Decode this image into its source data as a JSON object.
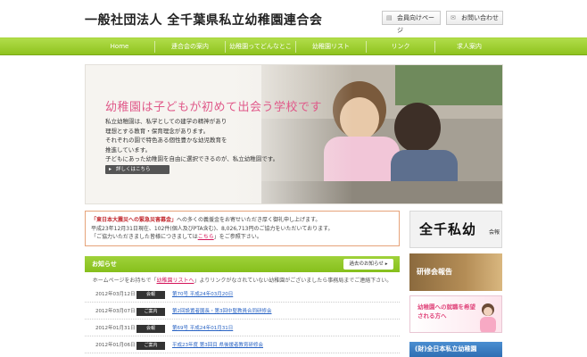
{
  "header": {
    "site_title": "一般社団法人 全千葉県私立幼稚園連合会",
    "member_page_label": "会員向けページ",
    "contact_label": "お問い合わせ"
  },
  "nav": {
    "items": [
      {
        "label": "Home"
      },
      {
        "label": "連合会の案内"
      },
      {
        "label": "幼稚園ってどんなところ?"
      },
      {
        "label": "幼稚園リスト"
      },
      {
        "label": "リンク"
      },
      {
        "label": "求人案内"
      }
    ]
  },
  "hero": {
    "headline": "幼稚園は子どもが初めて出会う学校です",
    "body_lines": [
      "私立幼稚園は、私学としての建学の精神があり",
      "理想とする教育・保育理念があります。",
      "それぞれの園で特色ある個性豊かな幼児教育を",
      "推進しています。",
      "子どもにあった幼稚園を自由に選択できるのが、私立幼稚園です。"
    ],
    "more_label": "詳しくはこちら"
  },
  "notice": {
    "title": "「東日本大震災への緊急災害募金」",
    "line1_rest": "への多くの義援金をお寄せいただき厚く御礼申し上げます。",
    "line2": "平成23年12月31日現在、102件(個人及びPTA含む)、8,026,713円のご協力をいただいております。",
    "line3_pre": "「ご協力いただきました皆様につきましては",
    "line3_link": "こちら",
    "line3_post": "」をご参照下さい。"
  },
  "news": {
    "title": "お知らせ",
    "archive_label": "過去のお知らせ",
    "note_pre": "ホームページをお持ちで「",
    "note_link": "幼稚園リストへ",
    "note_post": "」よりリンクがなされていない幼稚園がございましたら事務局までご連絡下さい。",
    "rows": [
      {
        "date": "2012年03月12日",
        "tag": "会報",
        "title": "第70号 平成24年03月20日"
      },
      {
        "date": "2012年03月07日",
        "tag": "ご案内",
        "title": "第2回設置者園長・第3回中堅教員合同研修会"
      },
      {
        "date": "2012年01月31日",
        "tag": "会報",
        "title": "第69号 平成24年01月31日"
      },
      {
        "date": "2012年01月06日",
        "tag": "ご案内",
        "title": "平成23年度 第3回目 県後援者教育研修会"
      }
    ]
  },
  "sidebar": {
    "kaiho_script": "全千私幼",
    "kaiho_label": "会報",
    "training_label": "研修会報告",
    "jobs_label": "幼稚園への就職を希望される方へ",
    "assoc_label": "(財)全日本私立幼稚園"
  },
  "colors": {
    "nav_green": "#8fc31f",
    "headline_pink": "#e05a8a",
    "link_blue": "#2a64c4",
    "notice_red": "#c1272d"
  }
}
